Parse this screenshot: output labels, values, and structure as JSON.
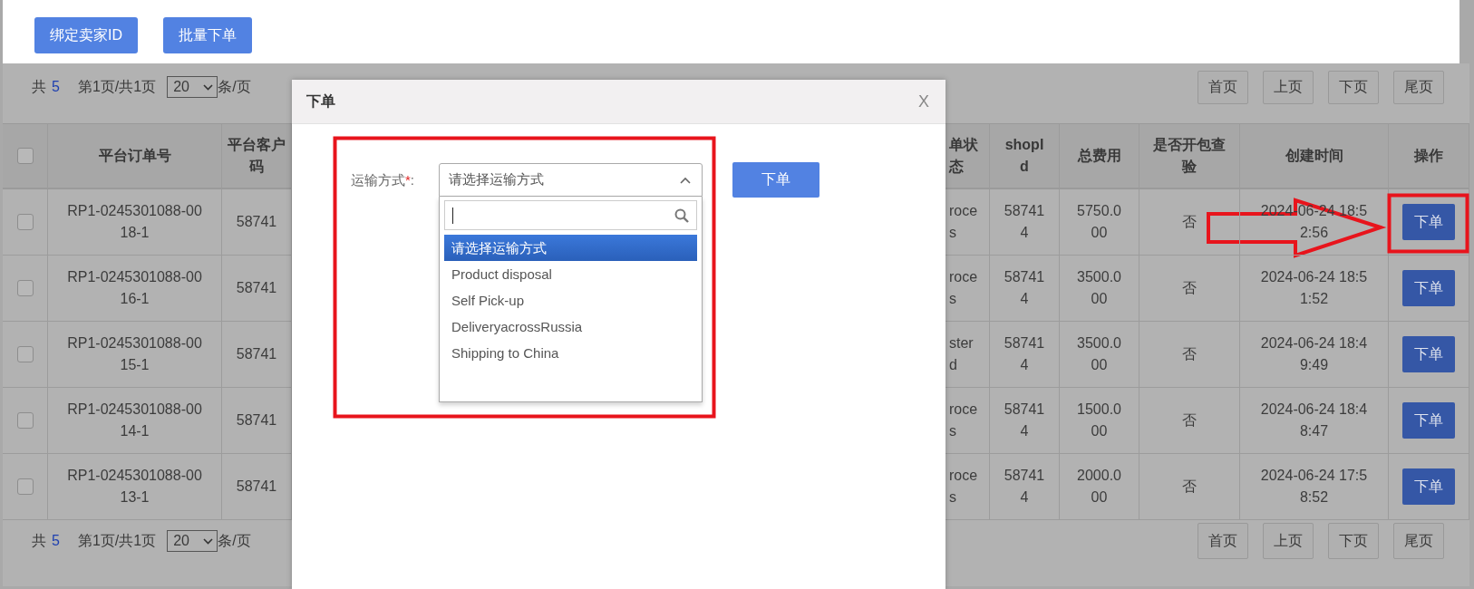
{
  "toolbar": {
    "buttons": [
      "绑定卖家ID",
      "批量下单"
    ]
  },
  "pagers": [
    {
      "total_label": "共",
      "total": "5",
      "page_info": "第1页/共1页",
      "page_size": "20",
      "page_size_suffix": "条/页",
      "buttons": [
        "首页",
        "上页",
        "下页",
        "尾页"
      ]
    },
    {
      "total_label": "共",
      "total": "5",
      "page_info": "第1页/共1页",
      "page_size": "20",
      "page_size_suffix": "条/页",
      "buttons": [
        "首页",
        "上页",
        "下页",
        "尾页"
      ]
    }
  ],
  "table": {
    "select_all": {
      "checked": false
    },
    "columns": [
      "平台订单号",
      "平台客户码",
      "单状态",
      "shopId",
      "总费用",
      "是否开包查验",
      "创建时间",
      "操作"
    ],
    "rows": [
      {
        "checked": false,
        "order_no": "RP1-0245301088-0018-1",
        "client_code": "58741",
        "status": "roce s",
        "shop_id": "587414",
        "total_fee": "5750.000",
        "inspection": "否",
        "created": "2024-06-24 18:52:56",
        "action": "下单"
      },
      {
        "checked": false,
        "order_no": "RP1-0245301088-0016-1",
        "client_code": "58741",
        "status": "roce s",
        "shop_id": "587414",
        "total_fee": "3500.000",
        "inspection": "否",
        "created": "2024-06-24 18:51:52",
        "action": "下单"
      },
      {
        "checked": false,
        "order_no": "RP1-0245301088-0015-1",
        "client_code": "58741",
        "status": "ster d",
        "shop_id": "587414",
        "total_fee": "3500.000",
        "inspection": "否",
        "created": "2024-06-24 18:49:49",
        "action": "下单"
      },
      {
        "checked": false,
        "order_no": "RP1-0245301088-0014-1",
        "client_code": "58741",
        "status": "roce s",
        "shop_id": "587414",
        "total_fee": "1500.000",
        "inspection": "否",
        "created": "2024-06-24 18:48:47",
        "action": "下单"
      },
      {
        "checked": false,
        "order_no": "RP1-0245301088-0013-1",
        "client_code": "58741",
        "status": "roce s",
        "shop_id": "587414",
        "total_fee": "2000.000",
        "inspection": "否",
        "created": "2024-06-24 17:58:52",
        "action": "下单"
      }
    ]
  },
  "modal": {
    "title": "下单",
    "close": "X",
    "field": {
      "label": "运输方式",
      "required_mark": "*",
      "label_suffix": ":",
      "value": "请选择运输方式",
      "expanded": true
    },
    "options": [
      {
        "label": "请选择运输方式",
        "selected": true
      },
      {
        "label": "Product disposal",
        "selected": false
      },
      {
        "label": "Self Pick-up",
        "selected": false
      },
      {
        "label": "DeliveryacrossRussia",
        "selected": false
      },
      {
        "label": "Shipping to China",
        "selected": false
      }
    ],
    "submit": "下单"
  }
}
